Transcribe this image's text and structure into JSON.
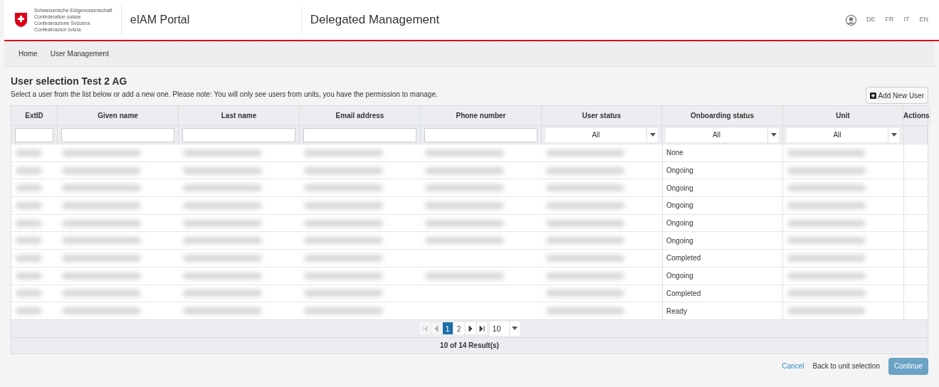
{
  "header": {
    "logo_lines": [
      "Schweizerische Eidgenossenschaft",
      "Confédération suisse",
      "Confederazione Svizzera",
      "Confederaziun svizra"
    ],
    "portal": "eIAM Portal",
    "app_title": "Delegated Management",
    "languages": [
      {
        "label": "DE",
        "selected": false
      },
      {
        "label": "FR",
        "selected": false
      },
      {
        "label": "IT",
        "selected": false
      },
      {
        "label": "EN",
        "selected": false
      }
    ]
  },
  "breadcrumb": [
    "Home",
    "User Management"
  ],
  "title": "User selection Test 2 AG",
  "subtitle": "Select a user from the list below or add a new one. Please note: You will only see users from units, you have the permission to manage.",
  "add_button": "Add New User",
  "table": {
    "columns": [
      {
        "label": "ExtID",
        "kind": "text"
      },
      {
        "label": "Given name",
        "kind": "text"
      },
      {
        "label": "Last name",
        "kind": "text"
      },
      {
        "label": "Email address",
        "kind": "text"
      },
      {
        "label": "Phone number",
        "kind": "text"
      },
      {
        "label": "User status",
        "kind": "select",
        "value": "All"
      },
      {
        "label": "Onboarding status",
        "kind": "select",
        "value": "All"
      },
      {
        "label": "Unit",
        "kind": "select",
        "value": "All"
      },
      {
        "label": "Actions",
        "kind": "none"
      }
    ],
    "rows": [
      {
        "onboarding": "None",
        "phone_blurred": true
      },
      {
        "onboarding": "Ongoing",
        "phone_blurred": true
      },
      {
        "onboarding": "Ongoing",
        "phone_blurred": true
      },
      {
        "onboarding": "Ongoing",
        "phone_blurred": true
      },
      {
        "onboarding": "Ongoing",
        "phone_blurred": true
      },
      {
        "onboarding": "Ongoing",
        "phone_blurred": true
      },
      {
        "onboarding": "Completed",
        "phone_blurred": false
      },
      {
        "onboarding": "Ongoing",
        "phone_blurred": true
      },
      {
        "onboarding": "Completed",
        "phone_blurred": false
      },
      {
        "onboarding": "Ready",
        "phone_blurred": false
      }
    ]
  },
  "pagination": {
    "pages": [
      {
        "label": "1",
        "selected": true
      },
      {
        "label": "2",
        "selected": false
      }
    ],
    "page_size": "10",
    "result": "10 of 14 Result(s)"
  },
  "footer": {
    "cancel": "Cancel",
    "back": "Back to unit selection",
    "continue": "Continue"
  }
}
